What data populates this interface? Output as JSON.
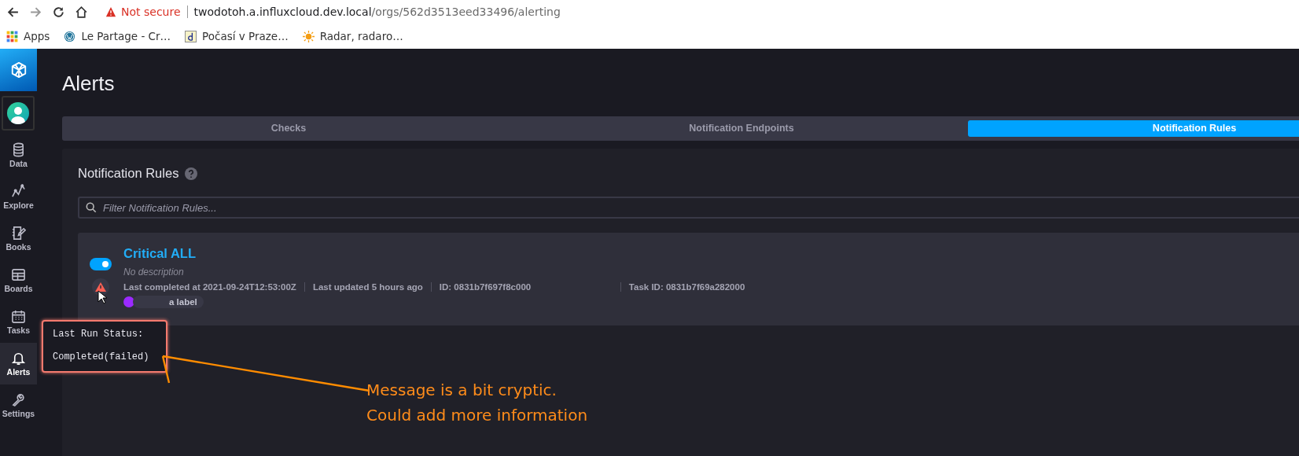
{
  "browser": {
    "security": "Not secure",
    "host": "twodotoh.a.influxcloud.dev.local",
    "path": "/orgs/562d3513eed33496/alerting",
    "bookmarks": [
      {
        "kind": "apps",
        "label": "Apps"
      },
      {
        "kind": "wordpress",
        "label": "Le Partage - Cr…"
      },
      {
        "kind": "letter",
        "label": "Počasí v Praze…"
      },
      {
        "kind": "sun",
        "label": "Radar, radaro…"
      }
    ]
  },
  "sidebar": {
    "items": [
      {
        "kind": "data",
        "label": "Data",
        "selected": false
      },
      {
        "kind": "explore",
        "label": "Explore",
        "selected": false
      },
      {
        "kind": "books",
        "label": "Books",
        "selected": false
      },
      {
        "kind": "boards",
        "label": "Boards",
        "selected": false
      },
      {
        "kind": "tasks",
        "label": "Tasks",
        "selected": false
      },
      {
        "kind": "alerts",
        "label": "Alerts",
        "selected": true
      },
      {
        "kind": "settings",
        "label": "Settings",
        "selected": false
      }
    ]
  },
  "page": {
    "title": "Alerts"
  },
  "tabs": [
    {
      "label": "Checks",
      "selected": false
    },
    {
      "label": "Notification Endpoints",
      "selected": false
    },
    {
      "label": "Notification Rules",
      "selected": true
    }
  ],
  "section": {
    "title": "Notification Rules",
    "filter": {
      "placeholder": "Filter Notification Rules..."
    }
  },
  "rules": [
    {
      "name": "Critical ALL",
      "enabled": true,
      "failed": true,
      "description": "No description",
      "meta": [
        "Last completed at 2021-09-24T12:53:00Z",
        "Last updated 5 hours ago",
        "ID: 0831b7f697f8c000",
        "Task ID: 0831b7f69a282000"
      ],
      "label": "a label"
    }
  ],
  "tooltip": {
    "title": "Last Run Status:",
    "text": "Completed(failed)"
  },
  "annotation": {
    "lines": [
      "Message is a bit cryptic.",
      "Could add more information"
    ]
  }
}
